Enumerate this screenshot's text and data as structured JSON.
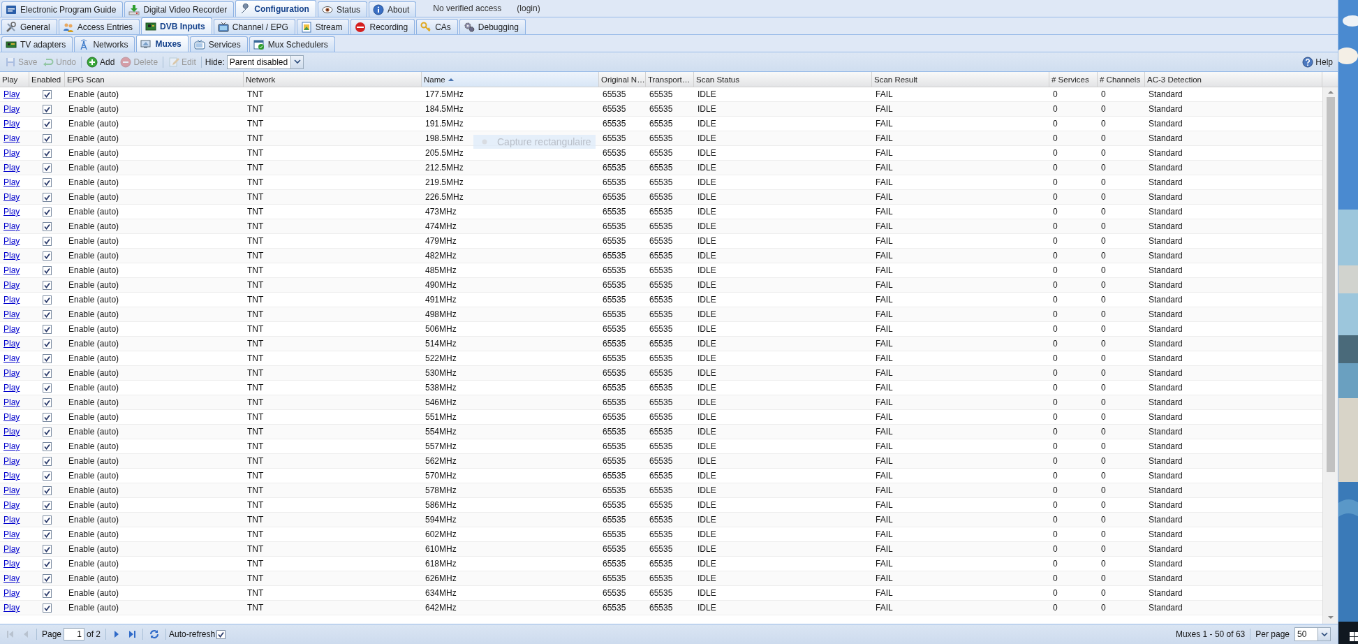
{
  "main_tabs": [
    {
      "label": "Electronic Program Guide",
      "selected": false
    },
    {
      "label": "Digital Video Recorder",
      "selected": false
    },
    {
      "label": "Configuration",
      "selected": true
    },
    {
      "label": "Status",
      "selected": false
    },
    {
      "label": "About",
      "selected": false
    }
  ],
  "access_status": "No verified access",
  "login_link": "(login)",
  "config_tabs": [
    {
      "label": "General",
      "selected": false
    },
    {
      "label": "Access Entries",
      "selected": false
    },
    {
      "label": "DVB Inputs",
      "selected": true
    },
    {
      "label": "Channel / EPG",
      "selected": false
    },
    {
      "label": "Stream",
      "selected": false
    },
    {
      "label": "Recording",
      "selected": false
    },
    {
      "label": "CAs",
      "selected": false
    },
    {
      "label": "Debugging",
      "selected": false
    }
  ],
  "dvb_tabs": [
    {
      "label": "TV adapters",
      "selected": false
    },
    {
      "label": "Networks",
      "selected": false
    },
    {
      "label": "Muxes",
      "selected": true
    },
    {
      "label": "Services",
      "selected": false
    },
    {
      "label": "Mux Schedulers",
      "selected": false
    }
  ],
  "toolbar": {
    "buttons": [
      {
        "label": "Save",
        "disabled": true
      },
      {
        "label": "Undo",
        "disabled": true
      },
      {
        "label": "Add",
        "disabled": false
      },
      {
        "label": "Delete",
        "disabled": true
      },
      {
        "label": "Edit",
        "disabled": true
      }
    ],
    "hide_label": "Hide:",
    "hide_value": "Parent disabled",
    "help": "Help"
  },
  "grid": {
    "columns": [
      {
        "label": "Play",
        "sorted": false
      },
      {
        "label": "Enabled",
        "sorted": false
      },
      {
        "label": "EPG Scan",
        "sorted": false
      },
      {
        "label": "Network",
        "sorted": false
      },
      {
        "label": "Name",
        "sorted": true
      },
      {
        "label": "Original N…",
        "sorted": false
      },
      {
        "label": "Transport…",
        "sorted": false
      },
      {
        "label": "Scan Status",
        "sorted": false
      },
      {
        "label": "Scan Result",
        "sorted": false
      },
      {
        "label": "# Services",
        "sorted": false
      },
      {
        "label": "# Channels",
        "sorted": false
      },
      {
        "label": "AC-3 Detection",
        "sorted": false
      }
    ],
    "rows": [
      {
        "play": "Play",
        "enabled": true,
        "epg_scan": "Enable (auto)",
        "network": "TNT",
        "name": "177.5MHz",
        "original_network_id": "65535",
        "transport_id": "65535",
        "scan_status": "IDLE",
        "scan_result": "FAIL",
        "services": "0",
        "channels": "0",
        "ac3_detection": "Standard"
      },
      {
        "play": "Play",
        "enabled": true,
        "epg_scan": "Enable (auto)",
        "network": "TNT",
        "name": "184.5MHz",
        "original_network_id": "65535",
        "transport_id": "65535",
        "scan_status": "IDLE",
        "scan_result": "FAIL",
        "services": "0",
        "channels": "0",
        "ac3_detection": "Standard"
      },
      {
        "play": "Play",
        "enabled": true,
        "epg_scan": "Enable (auto)",
        "network": "TNT",
        "name": "191.5MHz",
        "original_network_id": "65535",
        "transport_id": "65535",
        "scan_status": "IDLE",
        "scan_result": "FAIL",
        "services": "0",
        "channels": "0",
        "ac3_detection": "Standard"
      },
      {
        "play": "Play",
        "enabled": true,
        "epg_scan": "Enable (auto)",
        "network": "TNT",
        "name": "198.5MHz",
        "original_network_id": "65535",
        "transport_id": "65535",
        "scan_status": "IDLE",
        "scan_result": "FAIL",
        "services": "0",
        "channels": "0",
        "ac3_detection": "Standard"
      },
      {
        "play": "Play",
        "enabled": true,
        "epg_scan": "Enable (auto)",
        "network": "TNT",
        "name": "205.5MHz",
        "original_network_id": "65535",
        "transport_id": "65535",
        "scan_status": "IDLE",
        "scan_result": "FAIL",
        "services": "0",
        "channels": "0",
        "ac3_detection": "Standard"
      },
      {
        "play": "Play",
        "enabled": true,
        "epg_scan": "Enable (auto)",
        "network": "TNT",
        "name": "212.5MHz",
        "original_network_id": "65535",
        "transport_id": "65535",
        "scan_status": "IDLE",
        "scan_result": "FAIL",
        "services": "0",
        "channels": "0",
        "ac3_detection": "Standard"
      },
      {
        "play": "Play",
        "enabled": true,
        "epg_scan": "Enable (auto)",
        "network": "TNT",
        "name": "219.5MHz",
        "original_network_id": "65535",
        "transport_id": "65535",
        "scan_status": "IDLE",
        "scan_result": "FAIL",
        "services": "0",
        "channels": "0",
        "ac3_detection": "Standard"
      },
      {
        "play": "Play",
        "enabled": true,
        "epg_scan": "Enable (auto)",
        "network": "TNT",
        "name": "226.5MHz",
        "original_network_id": "65535",
        "transport_id": "65535",
        "scan_status": "IDLE",
        "scan_result": "FAIL",
        "services": "0",
        "channels": "0",
        "ac3_detection": "Standard"
      },
      {
        "play": "Play",
        "enabled": true,
        "epg_scan": "Enable (auto)",
        "network": "TNT",
        "name": "473MHz",
        "original_network_id": "65535",
        "transport_id": "65535",
        "scan_status": "IDLE",
        "scan_result": "FAIL",
        "services": "0",
        "channels": "0",
        "ac3_detection": "Standard"
      },
      {
        "play": "Play",
        "enabled": true,
        "epg_scan": "Enable (auto)",
        "network": "TNT",
        "name": "474MHz",
        "original_network_id": "65535",
        "transport_id": "65535",
        "scan_status": "IDLE",
        "scan_result": "FAIL",
        "services": "0",
        "channels": "0",
        "ac3_detection": "Standard"
      },
      {
        "play": "Play",
        "enabled": true,
        "epg_scan": "Enable (auto)",
        "network": "TNT",
        "name": "479MHz",
        "original_network_id": "65535",
        "transport_id": "65535",
        "scan_status": "IDLE",
        "scan_result": "FAIL",
        "services": "0",
        "channels": "0",
        "ac3_detection": "Standard"
      },
      {
        "play": "Play",
        "enabled": true,
        "epg_scan": "Enable (auto)",
        "network": "TNT",
        "name": "482MHz",
        "original_network_id": "65535",
        "transport_id": "65535",
        "scan_status": "IDLE",
        "scan_result": "FAIL",
        "services": "0",
        "channels": "0",
        "ac3_detection": "Standard"
      },
      {
        "play": "Play",
        "enabled": true,
        "epg_scan": "Enable (auto)",
        "network": "TNT",
        "name": "485MHz",
        "original_network_id": "65535",
        "transport_id": "65535",
        "scan_status": "IDLE",
        "scan_result": "FAIL",
        "services": "0",
        "channels": "0",
        "ac3_detection": "Standard"
      },
      {
        "play": "Play",
        "enabled": true,
        "epg_scan": "Enable (auto)",
        "network": "TNT",
        "name": "490MHz",
        "original_network_id": "65535",
        "transport_id": "65535",
        "scan_status": "IDLE",
        "scan_result": "FAIL",
        "services": "0",
        "channels": "0",
        "ac3_detection": "Standard"
      },
      {
        "play": "Play",
        "enabled": true,
        "epg_scan": "Enable (auto)",
        "network": "TNT",
        "name": "491MHz",
        "original_network_id": "65535",
        "transport_id": "65535",
        "scan_status": "IDLE",
        "scan_result": "FAIL",
        "services": "0",
        "channels": "0",
        "ac3_detection": "Standard"
      },
      {
        "play": "Play",
        "enabled": true,
        "epg_scan": "Enable (auto)",
        "network": "TNT",
        "name": "498MHz",
        "original_network_id": "65535",
        "transport_id": "65535",
        "scan_status": "IDLE",
        "scan_result": "FAIL",
        "services": "0",
        "channels": "0",
        "ac3_detection": "Standard"
      },
      {
        "play": "Play",
        "enabled": true,
        "epg_scan": "Enable (auto)",
        "network": "TNT",
        "name": "506MHz",
        "original_network_id": "65535",
        "transport_id": "65535",
        "scan_status": "IDLE",
        "scan_result": "FAIL",
        "services": "0",
        "channels": "0",
        "ac3_detection": "Standard"
      },
      {
        "play": "Play",
        "enabled": true,
        "epg_scan": "Enable (auto)",
        "network": "TNT",
        "name": "514MHz",
        "original_network_id": "65535",
        "transport_id": "65535",
        "scan_status": "IDLE",
        "scan_result": "FAIL",
        "services": "0",
        "channels": "0",
        "ac3_detection": "Standard"
      },
      {
        "play": "Play",
        "enabled": true,
        "epg_scan": "Enable (auto)",
        "network": "TNT",
        "name": "522MHz",
        "original_network_id": "65535",
        "transport_id": "65535",
        "scan_status": "IDLE",
        "scan_result": "FAIL",
        "services": "0",
        "channels": "0",
        "ac3_detection": "Standard"
      },
      {
        "play": "Play",
        "enabled": true,
        "epg_scan": "Enable (auto)",
        "network": "TNT",
        "name": "530MHz",
        "original_network_id": "65535",
        "transport_id": "65535",
        "scan_status": "IDLE",
        "scan_result": "FAIL",
        "services": "0",
        "channels": "0",
        "ac3_detection": "Standard"
      },
      {
        "play": "Play",
        "enabled": true,
        "epg_scan": "Enable (auto)",
        "network": "TNT",
        "name": "538MHz",
        "original_network_id": "65535",
        "transport_id": "65535",
        "scan_status": "IDLE",
        "scan_result": "FAIL",
        "services": "0",
        "channels": "0",
        "ac3_detection": "Standard"
      },
      {
        "play": "Play",
        "enabled": true,
        "epg_scan": "Enable (auto)",
        "network": "TNT",
        "name": "546MHz",
        "original_network_id": "65535",
        "transport_id": "65535",
        "scan_status": "IDLE",
        "scan_result": "FAIL",
        "services": "0",
        "channels": "0",
        "ac3_detection": "Standard"
      },
      {
        "play": "Play",
        "enabled": true,
        "epg_scan": "Enable (auto)",
        "network": "TNT",
        "name": "551MHz",
        "original_network_id": "65535",
        "transport_id": "65535",
        "scan_status": "IDLE",
        "scan_result": "FAIL",
        "services": "0",
        "channels": "0",
        "ac3_detection": "Standard"
      },
      {
        "play": "Play",
        "enabled": true,
        "epg_scan": "Enable (auto)",
        "network": "TNT",
        "name": "554MHz",
        "original_network_id": "65535",
        "transport_id": "65535",
        "scan_status": "IDLE",
        "scan_result": "FAIL",
        "services": "0",
        "channels": "0",
        "ac3_detection": "Standard"
      },
      {
        "play": "Play",
        "enabled": true,
        "epg_scan": "Enable (auto)",
        "network": "TNT",
        "name": "557MHz",
        "original_network_id": "65535",
        "transport_id": "65535",
        "scan_status": "IDLE",
        "scan_result": "FAIL",
        "services": "0",
        "channels": "0",
        "ac3_detection": "Standard"
      },
      {
        "play": "Play",
        "enabled": true,
        "epg_scan": "Enable (auto)",
        "network": "TNT",
        "name": "562MHz",
        "original_network_id": "65535",
        "transport_id": "65535",
        "scan_status": "IDLE",
        "scan_result": "FAIL",
        "services": "0",
        "channels": "0",
        "ac3_detection": "Standard"
      },
      {
        "play": "Play",
        "enabled": true,
        "epg_scan": "Enable (auto)",
        "network": "TNT",
        "name": "570MHz",
        "original_network_id": "65535",
        "transport_id": "65535",
        "scan_status": "IDLE",
        "scan_result": "FAIL",
        "services": "0",
        "channels": "0",
        "ac3_detection": "Standard"
      },
      {
        "play": "Play",
        "enabled": true,
        "epg_scan": "Enable (auto)",
        "network": "TNT",
        "name": "578MHz",
        "original_network_id": "65535",
        "transport_id": "65535",
        "scan_status": "IDLE",
        "scan_result": "FAIL",
        "services": "0",
        "channels": "0",
        "ac3_detection": "Standard"
      },
      {
        "play": "Play",
        "enabled": true,
        "epg_scan": "Enable (auto)",
        "network": "TNT",
        "name": "586MHz",
        "original_network_id": "65535",
        "transport_id": "65535",
        "scan_status": "IDLE",
        "scan_result": "FAIL",
        "services": "0",
        "channels": "0",
        "ac3_detection": "Standard"
      },
      {
        "play": "Play",
        "enabled": true,
        "epg_scan": "Enable (auto)",
        "network": "TNT",
        "name": "594MHz",
        "original_network_id": "65535",
        "transport_id": "65535",
        "scan_status": "IDLE",
        "scan_result": "FAIL",
        "services": "0",
        "channels": "0",
        "ac3_detection": "Standard"
      },
      {
        "play": "Play",
        "enabled": true,
        "epg_scan": "Enable (auto)",
        "network": "TNT",
        "name": "602MHz",
        "original_network_id": "65535",
        "transport_id": "65535",
        "scan_status": "IDLE",
        "scan_result": "FAIL",
        "services": "0",
        "channels": "0",
        "ac3_detection": "Standard"
      },
      {
        "play": "Play",
        "enabled": true,
        "epg_scan": "Enable (auto)",
        "network": "TNT",
        "name": "610MHz",
        "original_network_id": "65535",
        "transport_id": "65535",
        "scan_status": "IDLE",
        "scan_result": "FAIL",
        "services": "0",
        "channels": "0",
        "ac3_detection": "Standard"
      },
      {
        "play": "Play",
        "enabled": true,
        "epg_scan": "Enable (auto)",
        "network": "TNT",
        "name": "618MHz",
        "original_network_id": "65535",
        "transport_id": "65535",
        "scan_status": "IDLE",
        "scan_result": "FAIL",
        "services": "0",
        "channels": "0",
        "ac3_detection": "Standard"
      },
      {
        "play": "Play",
        "enabled": true,
        "epg_scan": "Enable (auto)",
        "network": "TNT",
        "name": "626MHz",
        "original_network_id": "65535",
        "transport_id": "65535",
        "scan_status": "IDLE",
        "scan_result": "FAIL",
        "services": "0",
        "channels": "0",
        "ac3_detection": "Standard"
      },
      {
        "play": "Play",
        "enabled": true,
        "epg_scan": "Enable (auto)",
        "network": "TNT",
        "name": "634MHz",
        "original_network_id": "65535",
        "transport_id": "65535",
        "scan_status": "IDLE",
        "scan_result": "FAIL",
        "services": "0",
        "channels": "0",
        "ac3_detection": "Standard"
      },
      {
        "play": "Play",
        "enabled": true,
        "epg_scan": "Enable (auto)",
        "network": "TNT",
        "name": "642MHz",
        "original_network_id": "65535",
        "transport_id": "65535",
        "scan_status": "IDLE",
        "scan_result": "FAIL",
        "services": "0",
        "channels": "0",
        "ac3_detection": "Standard"
      }
    ]
  },
  "pager": {
    "page_label": "Page",
    "page": "1",
    "of_pages": "of 2",
    "auto_refresh_label": "Auto-refresh",
    "auto_refresh": true,
    "first_disabled": true,
    "prev_disabled": true,
    "next_disabled": false,
    "last_disabled": false,
    "display": "Muxes 1 - 50 of 63",
    "per_page_label": "Per page",
    "per_page": "50"
  },
  "overlay_tooltip": "Capture rectangulaire"
}
